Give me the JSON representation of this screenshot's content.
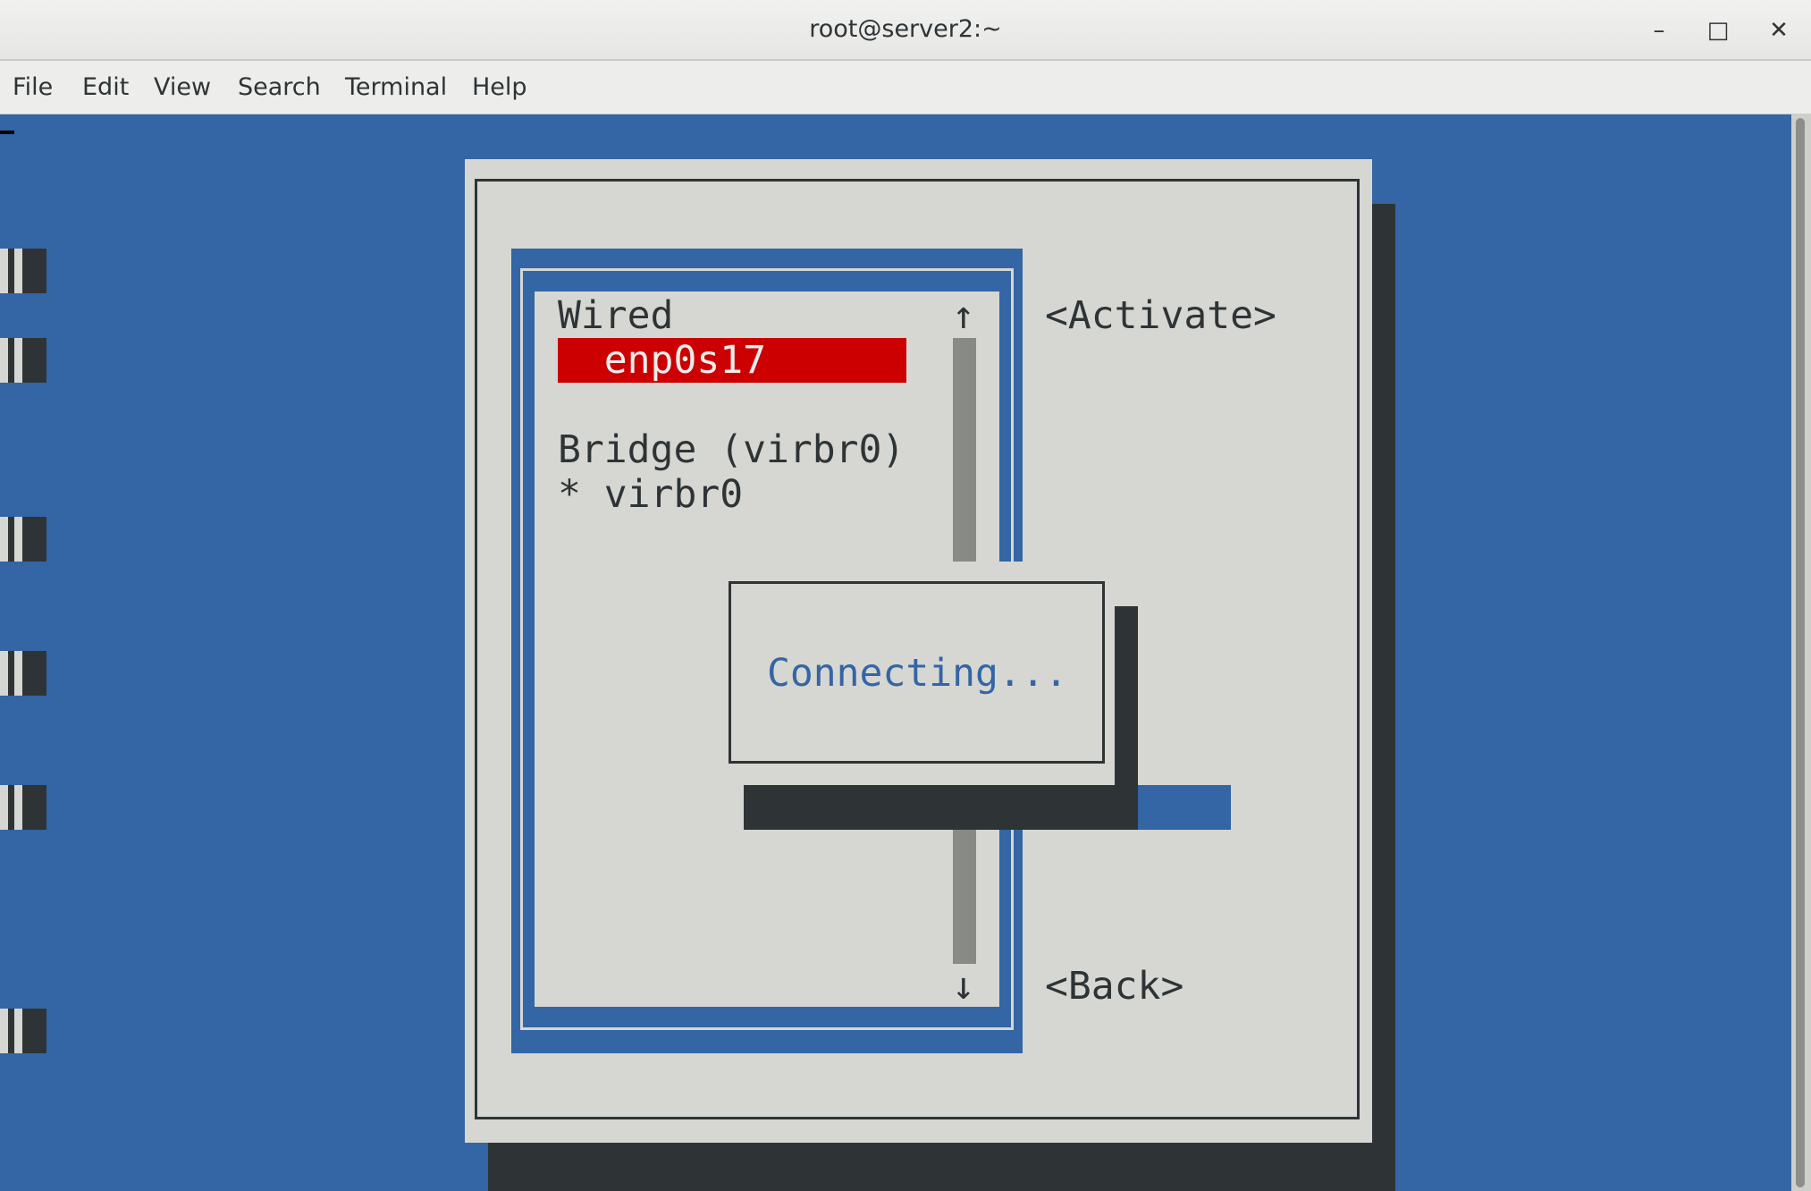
{
  "window": {
    "title": "root@server2:~",
    "controls": {
      "minimize": "–",
      "maximize": "□",
      "close": "✕"
    }
  },
  "menu": [
    "File",
    "Edit",
    "View",
    "Search",
    "Terminal",
    "Help"
  ],
  "nmtui": {
    "list": {
      "groups": [
        {
          "header": "Wired",
          "items": [
            "  enp0s17"
          ]
        },
        {
          "header": "Bridge (virbr0)",
          "items": [
            "* virbr0"
          ]
        }
      ],
      "scroll_up": "↑",
      "scroll_down": "↓"
    },
    "buttons": {
      "activate": "<Activate>",
      "back": "<Back>"
    },
    "popup": {
      "message": "Connecting..."
    }
  },
  "colors": {
    "terminal_bg": "#3465a5",
    "dialog_bg": "#d6d7d2",
    "shadow": "#2e3436",
    "selection": "#cc0000",
    "popup_text": "#3465a5"
  }
}
